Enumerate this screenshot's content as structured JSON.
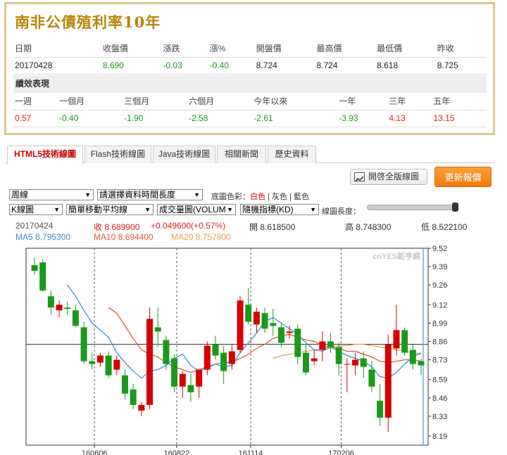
{
  "title": "南非公債殖利率10年",
  "quote": {
    "headers": [
      "日期",
      "收盤價",
      "漲跌",
      "漲%",
      "開盤價",
      "最高價",
      "最低價",
      "昨收"
    ],
    "values": [
      "20170428",
      "8.690",
      "-0.03",
      "-0.40",
      "8.724",
      "8.724",
      "8.618",
      "8.725"
    ]
  },
  "performance": {
    "title": "績效表現",
    "headers": [
      "一週",
      "一個月",
      "三個月",
      "六個月",
      "今年以來",
      "一年",
      "三年",
      "五年"
    ],
    "values": [
      "0.57",
      "-0.40",
      "-1.90",
      "-2.58",
      "-2.61",
      "-3.93",
      "4.13",
      "13.15"
    ]
  },
  "tabs": [
    "HTML5技術線圖",
    "Flash技術線圖",
    "Java技術線圖",
    "相關新聞",
    "歷史資料"
  ],
  "buttons": {
    "full_chart": "開啓全版線圖",
    "refresh": "更新報價"
  },
  "controls": {
    "period": "周線",
    "range": "請選擇資料時間長度",
    "color_label": "底圖色彩：",
    "color_white": "白色",
    "color_gray": "灰色",
    "color_blue": "藍色",
    "sep": "|",
    "kline": "K線圖",
    "ma_type": "簡單移動平均線",
    "volume": "成交量圖(VOLUM",
    "indicator": "隨機指標(KD)",
    "length_label": "線圖長度："
  },
  "info": {
    "date": "20170424",
    "close": "收 8.689900",
    "change": "+0.049600(+0.57%)",
    "open": "開 8.618500",
    "high": "高 8.748300",
    "low": "低 8.522100",
    "ma5": "MA5 8.795300",
    "ma10": "MA10 8.694400",
    "ma20": "MA20 8.757800"
  },
  "colors": {
    "up": "#d60000",
    "down": "#1a9a1a",
    "ma5": "#3a8fd6",
    "ma10": "#e05a30",
    "ma20": "#e8a050"
  },
  "chart_data": {
    "type": "candlestick",
    "watermark": "cnYES鉅亨網",
    "y_ticks": [
      "9.52",
      "9.39",
      "9.26",
      "9.12",
      "8.99",
      "8.86",
      "8.73",
      "8.59",
      "8.46",
      "8.33",
      "8.19"
    ],
    "ylim": [
      8.19,
      9.52
    ],
    "x_labels": [
      "160606",
      "160822",
      "161114",
      "170206"
    ],
    "reference_line": 8.84,
    "candles": [
      [
        9.4,
        9.45,
        9.33,
        9.36
      ],
      [
        9.42,
        9.44,
        9.21,
        9.22
      ],
      [
        9.18,
        9.22,
        9.05,
        9.1
      ],
      [
        9.08,
        9.15,
        9.03,
        9.12
      ],
      [
        9.1,
        9.14,
        9.05,
        9.09
      ],
      [
        9.08,
        9.12,
        8.96,
        8.97
      ],
      [
        8.96,
        9.0,
        8.7,
        8.72
      ],
      [
        8.72,
        8.78,
        8.66,
        8.7
      ],
      [
        8.71,
        8.78,
        8.68,
        8.76
      ],
      [
        8.76,
        8.79,
        8.6,
        8.62
      ],
      [
        8.66,
        8.76,
        8.62,
        8.73
      ],
      [
        8.62,
        8.66,
        8.45,
        8.49
      ],
      [
        8.52,
        8.56,
        8.38,
        8.41
      ],
      [
        8.37,
        8.43,
        8.33,
        8.41
      ],
      [
        8.41,
        9.1,
        8.38,
        9.02
      ],
      [
        8.96,
        9.1,
        8.82,
        8.93
      ],
      [
        8.87,
        8.9,
        8.66,
        8.7
      ],
      [
        8.74,
        8.77,
        8.5,
        8.54
      ],
      [
        8.54,
        8.65,
        8.46,
        8.63
      ],
      [
        8.55,
        8.63,
        8.43,
        8.5
      ],
      [
        8.54,
        8.66,
        8.46,
        8.66
      ],
      [
        8.66,
        8.86,
        8.62,
        8.83
      ],
      [
        8.84,
        8.9,
        8.73,
        8.76
      ],
      [
        8.78,
        8.83,
        8.56,
        8.65
      ],
      [
        8.7,
        8.84,
        8.66,
        8.79
      ],
      [
        8.8,
        9.18,
        8.78,
        9.15
      ],
      [
        9.12,
        9.24,
        8.98,
        9.0
      ],
      [
        8.98,
        9.1,
        8.92,
        9.07
      ],
      [
        9.06,
        9.1,
        8.92,
        8.95
      ],
      [
        8.99,
        9.09,
        8.9,
        8.97
      ],
      [
        8.96,
        8.99,
        8.82,
        8.85
      ],
      [
        8.92,
        8.97,
        8.88,
        8.93
      ],
      [
        8.95,
        8.98,
        8.7,
        8.75
      ],
      [
        8.78,
        8.84,
        8.62,
        8.64
      ],
      [
        8.72,
        8.8,
        8.69,
        8.74
      ],
      [
        8.8,
        8.93,
        8.72,
        8.86
      ],
      [
        8.86,
        8.92,
        8.78,
        8.82
      ],
      [
        8.82,
        8.85,
        8.62,
        8.7
      ],
      [
        8.7,
        8.74,
        8.5,
        8.7
      ],
      [
        8.69,
        8.78,
        8.62,
        8.73
      ],
      [
        8.74,
        8.79,
        8.6,
        8.68
      ],
      [
        8.66,
        8.72,
        8.5,
        8.54
      ],
      [
        8.44,
        8.56,
        8.26,
        8.32
      ],
      [
        8.32,
        8.91,
        8.22,
        8.84
      ],
      [
        8.81,
        9.12,
        8.76,
        8.94
      ],
      [
        8.94,
        8.96,
        8.76,
        8.78
      ],
      [
        8.8,
        8.84,
        8.66,
        8.7
      ],
      [
        8.72,
        8.74,
        8.62,
        8.69
      ]
    ],
    "ma5": [
      null,
      null,
      null,
      null,
      9.26,
      9.18,
      9.08,
      8.99,
      8.94,
      8.89,
      8.78,
      8.71,
      8.65,
      8.6,
      8.65,
      8.66,
      8.69,
      8.74,
      8.77,
      8.69,
      8.65,
      8.67,
      8.7,
      8.68,
      8.69,
      8.78,
      8.85,
      8.92,
      9.0,
      9.03,
      8.99,
      8.95,
      8.91,
      8.85,
      8.8,
      8.79,
      8.82,
      8.79,
      8.76,
      8.74,
      8.72,
      8.68,
      8.61,
      8.6,
      8.64,
      8.7,
      8.75,
      8.78
    ],
    "ma10": [
      null,
      null,
      null,
      null,
      null,
      null,
      null,
      null,
      null,
      9.1,
      9.06,
      8.97,
      8.88,
      8.8,
      8.77,
      8.75,
      8.71,
      8.68,
      8.66,
      8.64,
      8.66,
      8.68,
      8.7,
      8.71,
      8.71,
      8.74,
      8.77,
      8.81,
      8.84,
      8.88,
      8.9,
      8.91,
      8.89,
      8.87,
      8.86,
      8.83,
      8.82,
      8.81,
      8.79,
      8.79,
      8.77,
      8.75,
      8.72,
      8.71,
      8.72,
      8.73,
      8.73,
      8.72
    ],
    "ma20": [
      null,
      null,
      null,
      null,
      null,
      null,
      null,
      null,
      null,
      null,
      null,
      null,
      null,
      null,
      null,
      null,
      null,
      null,
      null,
      null,
      null,
      null,
      null,
      null,
      null,
      null,
      null,
      null,
      null,
      8.74,
      8.76,
      8.77,
      8.78,
      8.79,
      8.8,
      8.81,
      8.82,
      8.83,
      8.83,
      8.84,
      8.84,
      8.83,
      8.82,
      8.81,
      8.8,
      8.79,
      8.78,
      8.77
    ]
  }
}
